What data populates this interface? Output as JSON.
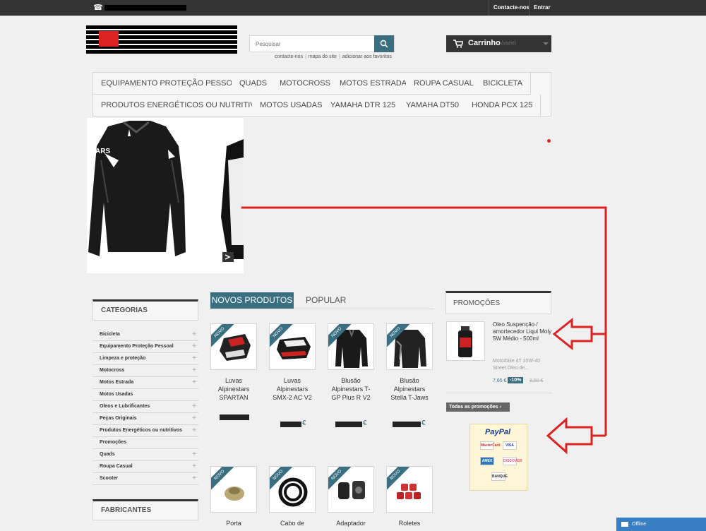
{
  "topbar": {
    "phone_icon": "phone-icon",
    "contact_label": "Contacte-nos",
    "login_label": "Entrar"
  },
  "search": {
    "placeholder": "Pesquisar",
    "icon": "search-icon"
  },
  "sublinks": [
    "contacte-nos",
    "mapa do site",
    "adicionar aos favoritos"
  ],
  "cart": {
    "label": "Carrinho",
    "status": "(vazio)",
    "icon": "cart-icon"
  },
  "menu": {
    "row1": [
      "EQUIPAMENTO PROTEÇÃO PESSOAL",
      "QUADS",
      "MOTOCROSS",
      "MOTOS ESTRADA",
      "ROUPA CASUAL",
      "BICICLETA"
    ],
    "row2": [
      "PRODUTOS ENERGÉTICOS OU NUTRITIVOS",
      "MOTOS USADAS",
      "YAMAHA DTR 125",
      "YAMAHA DT50",
      "HONDA PCX 125"
    ]
  },
  "slider": {
    "brand_text": "STARS"
  },
  "categories": {
    "title": "CATEGORIAS",
    "items": [
      {
        "label": "Bicicleta",
        "expand": true
      },
      {
        "label": "Equipamento Proteção Pessoal",
        "expand": true
      },
      {
        "label": "Limpeza e proteção",
        "expand": true
      },
      {
        "label": "Motocross",
        "expand": true
      },
      {
        "label": "Motos Estrada",
        "expand": true
      },
      {
        "label": "Motos Usadas",
        "expand": false
      },
      {
        "label": "Oleos e Lubrificantes",
        "expand": true
      },
      {
        "label": "Peças Originais",
        "expand": true
      },
      {
        "label": "Produtos Energéticos ou nutritivos",
        "expand": true
      },
      {
        "label": "Promoções",
        "expand": false
      },
      {
        "label": "Quads",
        "expand": true
      },
      {
        "label": "Roupa Casual",
        "expand": true
      },
      {
        "label": "Scooter",
        "expand": true
      }
    ]
  },
  "manufacturers": {
    "title": "FABRICANTES"
  },
  "tabs": {
    "new_label": "NOVOS PRODUTOS",
    "popular_label": "POPULAR"
  },
  "products": {
    "ribbon": "NOVO",
    "currency": "€",
    "row1": [
      "Luvas Alpinestars SPARTAN",
      "Luvas Alpinestars SMX-2 AC V2",
      "Blusão Alpinestars T-GP Plus R V2",
      "Blusão Alpinestars Stella T-Jaws"
    ],
    "row2": [
      "Porta",
      "Cabo de",
      "Adaptador",
      "Roletes"
    ]
  },
  "promotions": {
    "title": "PROMOÇÕES",
    "product_title": "Oleo Suspenção / amortecedor Liqui Moly 5W Médio - 500ml",
    "product_desc": "Motorbike 4T 10W-40 Street Óleo de...",
    "price": "7,65 €",
    "discount": "-10%",
    "old_price": "8,50 €",
    "all_label": "Todas as promoções"
  },
  "paypal": {
    "brand": "PayPal",
    "cards": [
      "MasterCard",
      "VISA",
      "AMEX",
      "DISCOVER",
      "BANQUE"
    ]
  },
  "chat": {
    "label": "Offline"
  },
  "colors": {
    "accent": "#3a6f82",
    "topbar": "#333333",
    "annotation_red": "#dd2222"
  }
}
